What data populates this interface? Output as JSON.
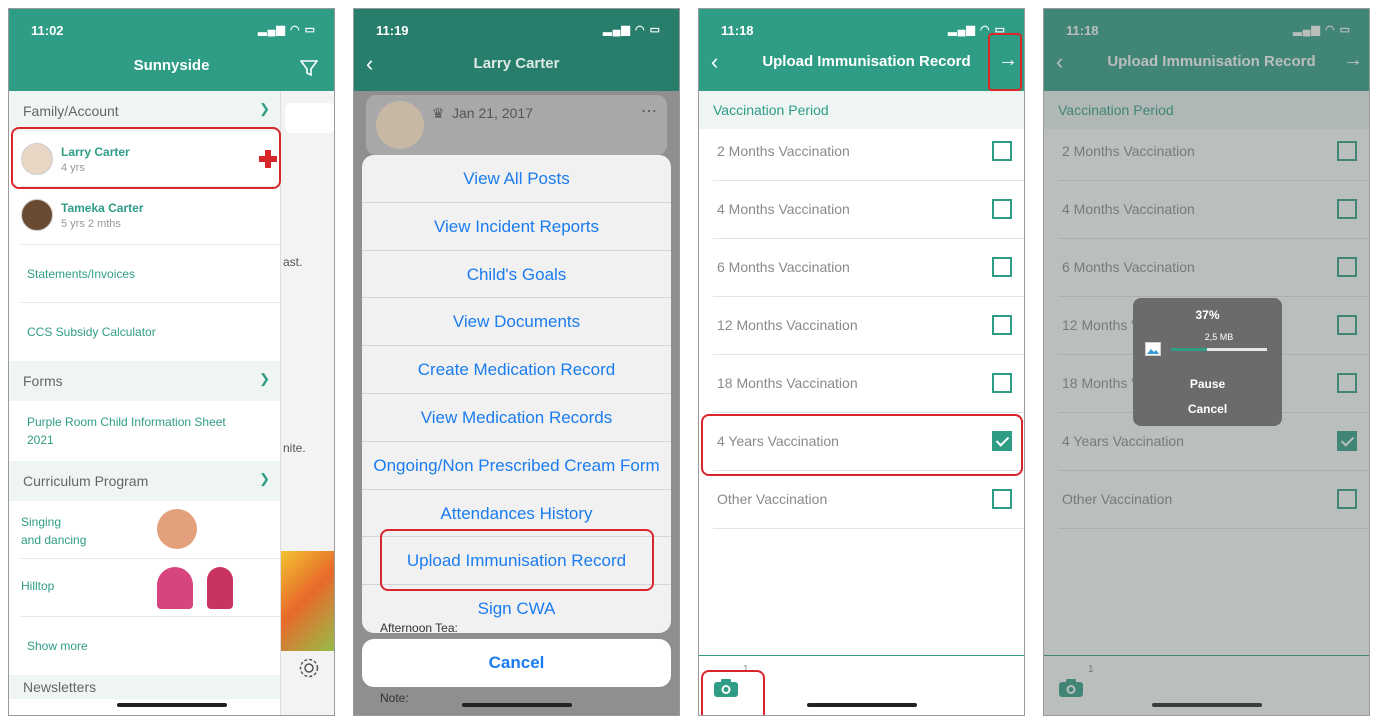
{
  "panel1": {
    "time": "11:02",
    "title": "Sunnyside",
    "sections": {
      "family": "Family/Account",
      "forms": "Forms",
      "curriculum": "Curriculum Program",
      "newsletters": "Newsletters"
    },
    "children": [
      {
        "name": "Larry Carter",
        "age": "4 yrs"
      },
      {
        "name": "Tameka Carter",
        "age": "5 yrs 2 mths"
      }
    ],
    "links": {
      "statements": "Statements/Invoices",
      "ccs": "CCS Subsidy Calculator",
      "form1": "Purple Room Child Information Sheet 2021",
      "singing": "Singing\nand dancing",
      "hilltop": "Hilltop",
      "show_more": "Show more"
    },
    "behind_text": {
      "a": "ast.",
      "b": "nite."
    }
  },
  "panel2": {
    "time": "11:19",
    "title": "Larry Carter",
    "birth_date": "Jan 21, 2017",
    "menu": [
      "View All Posts",
      "View Incident Reports",
      "Child's Goals",
      "View Documents",
      "Create Medication Record",
      "View Medication Records",
      "Ongoing/Non Prescribed Cream Form",
      "Attendances History",
      "Upload Immunisation Record",
      "Sign CWA"
    ],
    "cancel": "Cancel",
    "behind_text": {
      "a": "Afternoon Tea:",
      "note": "Note:"
    }
  },
  "panel3": {
    "time": "11:18",
    "title": "Upload Immunisation Record",
    "period_label": "Vaccination Period",
    "items": [
      {
        "label": "2 Months Vaccination",
        "checked": false
      },
      {
        "label": "4 Months Vaccination",
        "checked": false
      },
      {
        "label": "6 Months Vaccination",
        "checked": false
      },
      {
        "label": "12 Months Vaccination",
        "checked": false
      },
      {
        "label": "18 Months Vaccination",
        "checked": false
      },
      {
        "label": "4 Years Vaccination",
        "checked": true
      },
      {
        "label": "Other Vaccination",
        "checked": false
      }
    ],
    "photo_count": "1"
  },
  "panel4": {
    "time": "11:18",
    "title": "Upload Immunisation Record",
    "period_label": "Vaccination Period",
    "progress_percent": "37%",
    "progress_fraction": 0.37,
    "file_size": "2,5 MB",
    "pause": "Pause",
    "cancel": "Cancel",
    "photo_count": "1"
  },
  "colors": {
    "brand": "#2f9d86",
    "highlight": "#d9262a",
    "ios_blue": "#1a7cf0"
  }
}
